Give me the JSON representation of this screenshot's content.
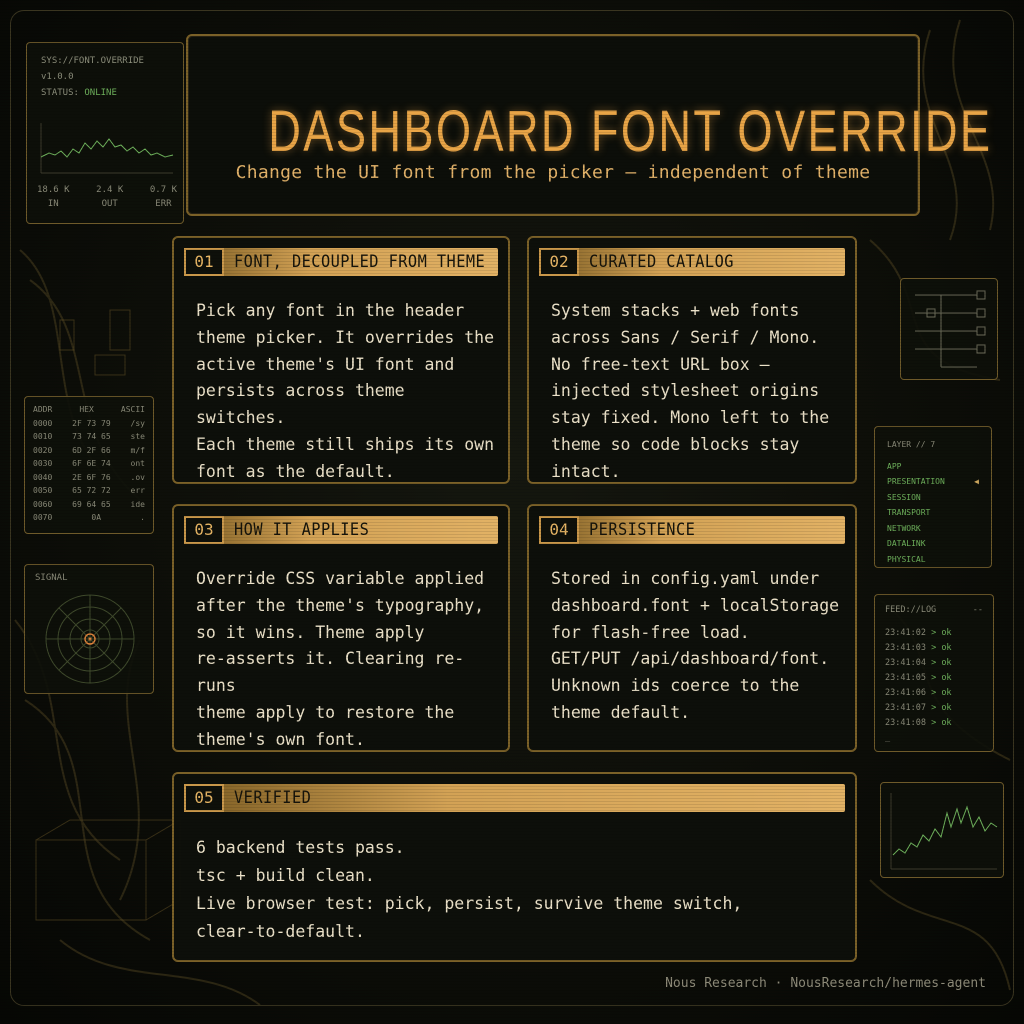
{
  "sys_panel": {
    "line1": "SYS://FONT.OVERRIDE",
    "line2": "v1.0.0",
    "status_label": "STATUS:",
    "status_value": "ONLINE",
    "stats": [
      {
        "value": "18.6 K",
        "label": "IN"
      },
      {
        "value": "2.4 K",
        "label": "OUT"
      },
      {
        "value": "0.7 K",
        "label": "ERR"
      }
    ]
  },
  "hex_panel": {
    "headers": [
      "ADDR",
      "HEX",
      "ASCII"
    ],
    "rows": [
      [
        "0000",
        "2F 73 79",
        "/sy"
      ],
      [
        "0010",
        "73 74 65",
        "ste"
      ],
      [
        "0020",
        "6D 2F 66",
        "m/f"
      ],
      [
        "0030",
        "6F 6E 74",
        "ont"
      ],
      [
        "0040",
        "2E 6F 76",
        ".ov"
      ],
      [
        "0050",
        "65 72 72",
        "err"
      ],
      [
        "0060",
        "69 64 65",
        "ide"
      ],
      [
        "0070",
        "0A",
        "."
      ]
    ]
  },
  "signal_panel": {
    "label": "SIGNAL"
  },
  "layer_panel": {
    "title": "LAYER  //  7",
    "items": [
      "APP",
      "PRESENTATION",
      "SESSION",
      "TRANSPORT",
      "NETWORK",
      "DATALINK",
      "PHYSICAL"
    ],
    "marker": "◀"
  },
  "feed_panel": {
    "title": "FEED://LOG",
    "dash": "--",
    "entries": [
      {
        "time": "23:41:02",
        "msg": "> ok"
      },
      {
        "time": "23:41:03",
        "msg": "> ok"
      },
      {
        "time": "23:41:04",
        "msg": "> ok"
      },
      {
        "time": "23:41:05",
        "msg": "> ok"
      },
      {
        "time": "23:41:06",
        "msg": "> ok"
      },
      {
        "time": "23:41:07",
        "msg": "> ok"
      },
      {
        "time": "23:41:08",
        "msg": "> ok"
      }
    ],
    "cursor": "_"
  },
  "header": {
    "title": "DASHBOARD FONT OVERRIDE",
    "subtitle": "Change the UI font from the picker — independent of theme"
  },
  "cards": [
    {
      "num": "01",
      "title": "FONT, DECOUPLED FROM THEME",
      "body": "Pick any font in the header\ntheme picker. It overrides the\nactive theme's UI font and\npersists across theme switches.\nEach theme still ships its own\nfont as the default."
    },
    {
      "num": "02",
      "title": "CURATED CATALOG",
      "body": "System stacks + web fonts\nacross Sans / Serif / Mono.\nNo free-text URL box —\ninjected stylesheet origins\nstay fixed. Mono left to the\ntheme so code blocks stay intact."
    },
    {
      "num": "03",
      "title": "HOW IT APPLIES",
      "body": "Override CSS variable applied\nafter the theme's typography,\nso it wins. Theme apply\nre-asserts it. Clearing re-runs\ntheme apply to restore the\ntheme's own font."
    },
    {
      "num": "04",
      "title": "PERSISTENCE",
      "body": "Stored in config.yaml under\ndashboard.font + localStorage\nfor flash-free load.\nGET/PUT /api/dashboard/font.\nUnknown ids coerce to the\ntheme default."
    },
    {
      "num": "05",
      "title": "VERIFIED",
      "body": "6 backend tests pass.\ntsc + build clean.\nLive browser test: pick, persist, survive theme switch,\nclear-to-default."
    }
  ],
  "footer": "Nous Research · NousResearch/hermes-agent"
}
